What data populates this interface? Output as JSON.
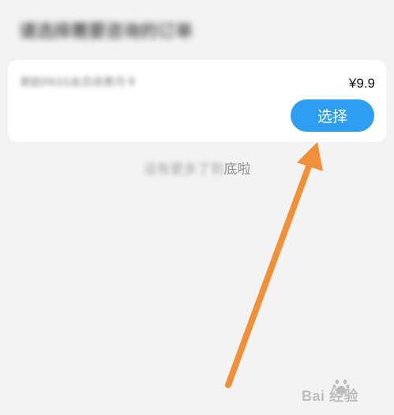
{
  "page": {
    "title": "请选择需要咨询的订单",
    "end_prefix": "没有更多了到",
    "end_suffix": "底啦"
  },
  "order": {
    "name": "刷脸PASS会员续费月卡",
    "price": "¥9.9",
    "select_label": "选择"
  },
  "annotation": {
    "arrow_color": "#f0913a",
    "icon": "arrow-up-icon"
  },
  "watermark": {
    "text": "Bai 经验",
    "logo": "baidu-paw-icon"
  },
  "colors": {
    "background": "#f3f3f3",
    "card": "#ffffff",
    "accent": "#2e9ef2",
    "annotation": "#f0913a"
  }
}
